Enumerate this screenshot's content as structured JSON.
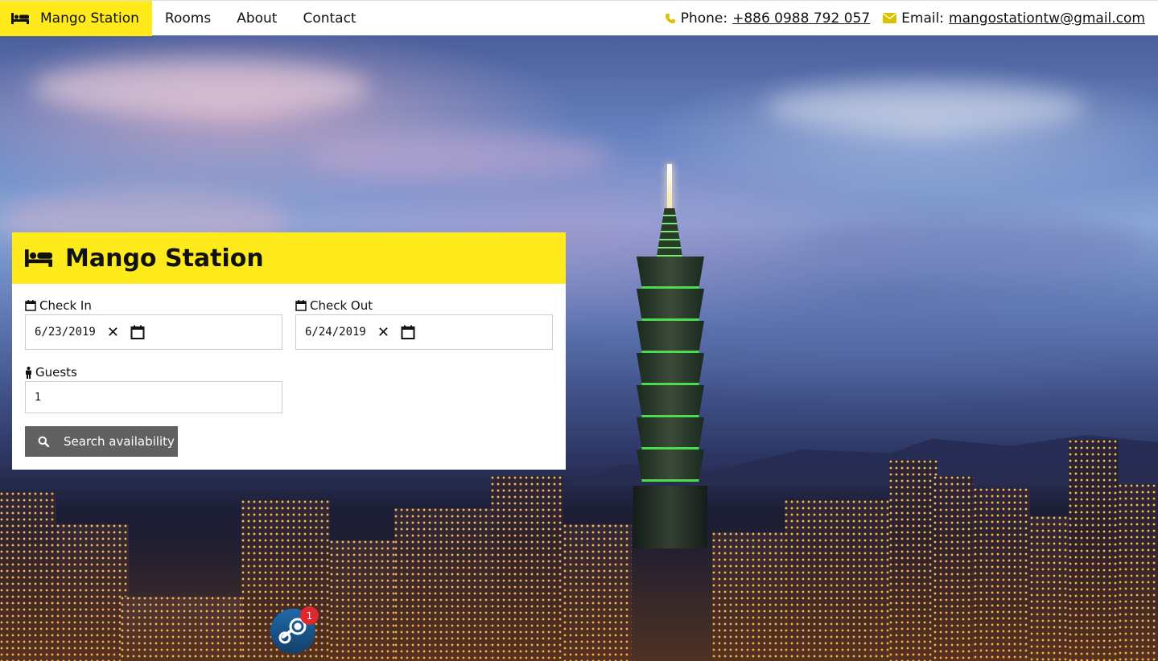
{
  "navbar": {
    "brand": {
      "label": "Mango Station",
      "icon": "bed-icon"
    },
    "links": [
      {
        "label": "Rooms"
      },
      {
        "label": "About"
      },
      {
        "label": "Contact"
      }
    ],
    "phone": {
      "label": "Phone:",
      "value": "+886 0988 792 057",
      "icon": "phone-icon"
    },
    "email": {
      "label": "Email:",
      "value": "mangostationtw@gmail.com",
      "icon": "envelope-icon"
    }
  },
  "booking": {
    "title": "Mango Station",
    "title_icon": "bed-icon",
    "check_in": {
      "label": "Check In",
      "value": "6/23/2019",
      "icon": "calendar-icon"
    },
    "check_out": {
      "label": "Check Out",
      "value": "6/24/2019",
      "icon": "calendar-icon"
    },
    "guests": {
      "label": "Guests",
      "value": "1",
      "icon": "person-icon"
    },
    "search_button": {
      "label": "Search availability",
      "icon": "search-icon"
    }
  },
  "notification": {
    "count": "1",
    "icon": "steam-icon"
  },
  "colors": {
    "accent": "#ffeb1b",
    "button": "#616161",
    "icon_yellow": "#d9c300",
    "badge": "#e0262f"
  }
}
